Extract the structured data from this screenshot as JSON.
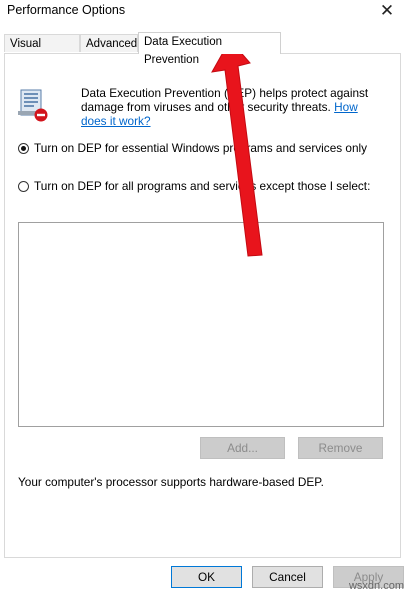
{
  "window": {
    "title": "Performance Options",
    "close_glyph": "✕"
  },
  "tabs": [
    {
      "label": "Visual Effects"
    },
    {
      "label": "Advanced"
    },
    {
      "label": "Data Execution Prevention"
    }
  ],
  "dep": {
    "description": "Data Execution Prevention (DEP) helps protect against damage from viruses and other security threats.",
    "link": "How does it work?",
    "option_essential": "Turn on DEP for essential Windows programs and services only",
    "option_all": "Turn on DEP for all programs and services except those I select:",
    "add_label": "Add...",
    "remove_label": "Remove",
    "support_text": "Your computer's processor supports hardware-based DEP."
  },
  "footer": {
    "ok_label": "OK",
    "cancel_label": "Cancel",
    "apply_label": "Apply"
  },
  "watermark": "wsxdn.com",
  "colors": {
    "accent": "#0078d7",
    "link": "#0066cc",
    "annotation_arrow": "#e8141c"
  },
  "icons": {
    "dep": "dep-shield-icon",
    "close": "close-icon"
  }
}
